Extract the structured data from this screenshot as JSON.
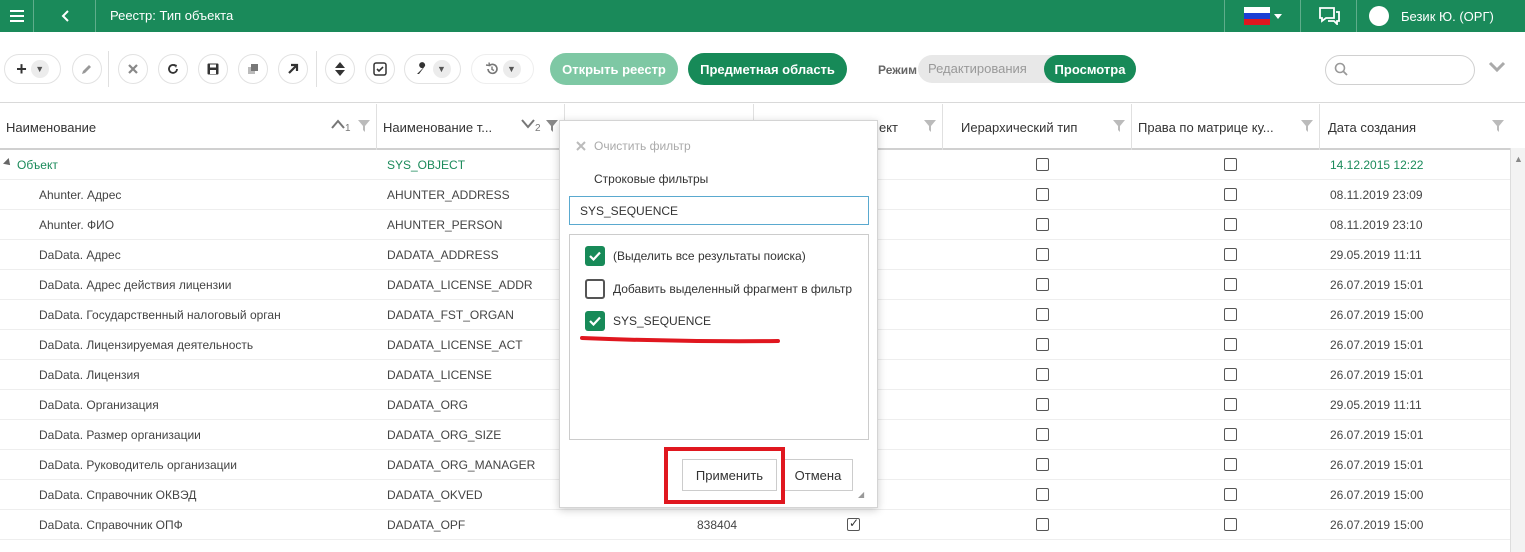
{
  "topbar": {
    "title": "Реестр: Тип объекта",
    "user_name": "Безик Ю. (ОРГ)"
  },
  "toolbar": {
    "open_registry_label": "Открыть реестр",
    "subject_area_label": "Предметная область",
    "mode_label": "Режим",
    "mode_edit_label": "Редактирования",
    "mode_view_label": "Просмотра",
    "search_placeholder": ""
  },
  "columns": [
    {
      "label": "Наименование",
      "sort_index": "1"
    },
    {
      "label": "Наименование т...",
      "sort_index": "2"
    },
    {
      "label": ""
    },
    {
      "label": "ект"
    },
    {
      "label": "Иерархический тип"
    },
    {
      "label": "Права по матрице ку..."
    },
    {
      "label": "Дата создания"
    }
  ],
  "rows": [
    {
      "name": "Объект",
      "code": "SYS_OBJECT",
      "col3": "",
      "date": "14.12.2015 12:22",
      "root": true
    },
    {
      "name": "Ahunter. Адрес",
      "code": "AHUNTER_ADDRESS",
      "col3": "",
      "date": "08.11.2019 23:09"
    },
    {
      "name": "Ahunter. ФИО",
      "code": "AHUNTER_PERSON",
      "col3": "",
      "date": "08.11.2019 23:10"
    },
    {
      "name": "DaData. Адрес",
      "code": "DADATA_ADDRESS",
      "col3": "",
      "date": "29.05.2019 11:11"
    },
    {
      "name": "DaData. Адрес действия лицензии",
      "code": "DADATA_LICENSE_ADDR",
      "col3": "",
      "date": "26.07.2019 15:01"
    },
    {
      "name": "DaData. Государственный налоговый орган",
      "code": "DADATA_FST_ORGAN",
      "col3": "",
      "date": "26.07.2019 15:00"
    },
    {
      "name": "DaData. Лицензируемая деятельность",
      "code": "DADATA_LICENSE_ACT",
      "col3": "",
      "date": "26.07.2019 15:01"
    },
    {
      "name": "DaData. Лицензия",
      "code": "DADATA_LICENSE",
      "col3": "",
      "date": "26.07.2019 15:01"
    },
    {
      "name": "DaData. Организация",
      "code": "DADATA_ORG",
      "col3": "",
      "date": "29.05.2019 11:11"
    },
    {
      "name": "DaData. Размер организации",
      "code": "DADATA_ORG_SIZE",
      "col3": "",
      "date": "26.07.2019 15:01"
    },
    {
      "name": "DaData. Руководитель организации",
      "code": "DADATA_ORG_MANAGER",
      "col3": "",
      "date": "26.07.2019 15:01"
    },
    {
      "name": "DaData. Справочник ОКВЭД",
      "code": "DADATA_OKVED",
      "col3": "",
      "date": "26.07.2019 15:00"
    },
    {
      "name": "DaData. Справочник ОПФ",
      "code": "DADATA_OPF",
      "col3": "838404",
      "date": "26.07.2019 15:00",
      "obj_checked": true
    }
  ],
  "filter_popup": {
    "clear_label": "Очистить фильтр",
    "string_filters_label": "Строковые фильтры",
    "search_value": "SYS_SEQUENCE",
    "items": [
      {
        "label": "(Выделить все результаты поиска)",
        "checked": true
      },
      {
        "label": "Добавить выделенный фрагмент в фильтр",
        "checked": false
      },
      {
        "label": "SYS_SEQUENCE",
        "checked": true
      }
    ],
    "apply_label": "Применить",
    "cancel_label": "Отмена"
  },
  "colors": {
    "brand": "#1a8a5a",
    "highlight": "#e0171f"
  }
}
